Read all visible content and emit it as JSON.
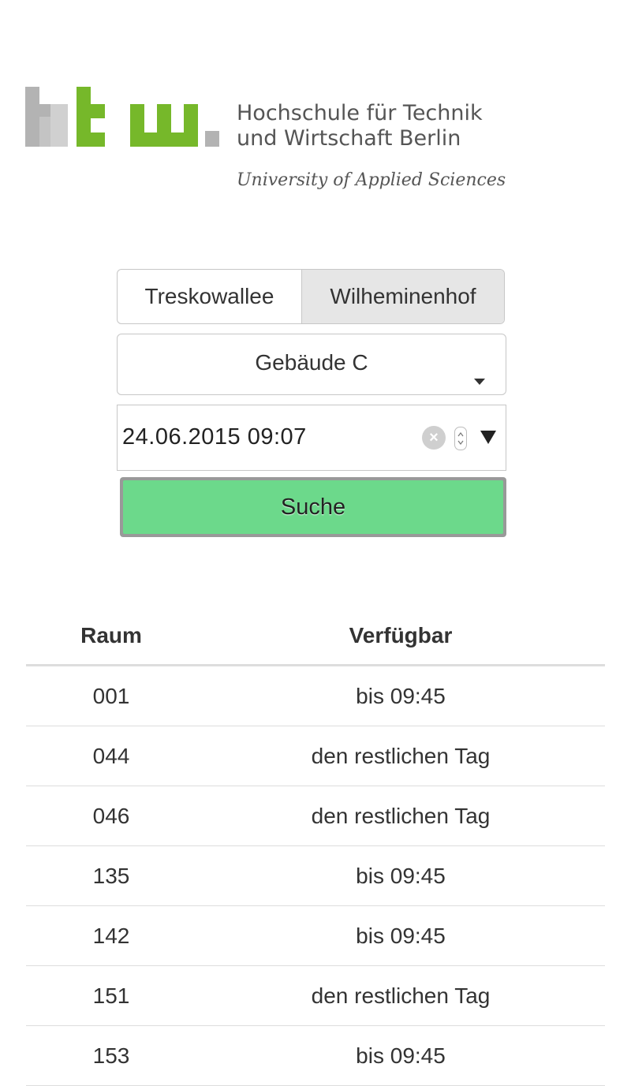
{
  "logo": {
    "mark_text": "htw",
    "name_line1": "Hochschule für Technik",
    "name_line2": "und Wirtschaft Berlin",
    "subtitle": "University of Applied Sciences",
    "colors": {
      "grey": "#b3b3b3",
      "green": "#76b82a"
    }
  },
  "campus": {
    "options": [
      {
        "label": "Treskowallee",
        "active": false
      },
      {
        "label": "Wilheminenhof",
        "active": true
      }
    ]
  },
  "building": {
    "selected": "Gebäude C"
  },
  "datetime": {
    "value": "24.06.2015 09:07"
  },
  "search": {
    "label": "Suche",
    "color": "#6cd98b"
  },
  "table": {
    "headers": {
      "room": "Raum",
      "available": "Verfügbar"
    },
    "rows": [
      {
        "room": "001",
        "available": "bis 09:45"
      },
      {
        "room": "044",
        "available": "den restlichen Tag"
      },
      {
        "room": "046",
        "available": "den restlichen Tag"
      },
      {
        "room": "135",
        "available": "bis 09:45"
      },
      {
        "room": "142",
        "available": "bis 09:45"
      },
      {
        "room": "151",
        "available": "den restlichen Tag"
      },
      {
        "room": "153",
        "available": "bis 09:45"
      }
    ]
  }
}
